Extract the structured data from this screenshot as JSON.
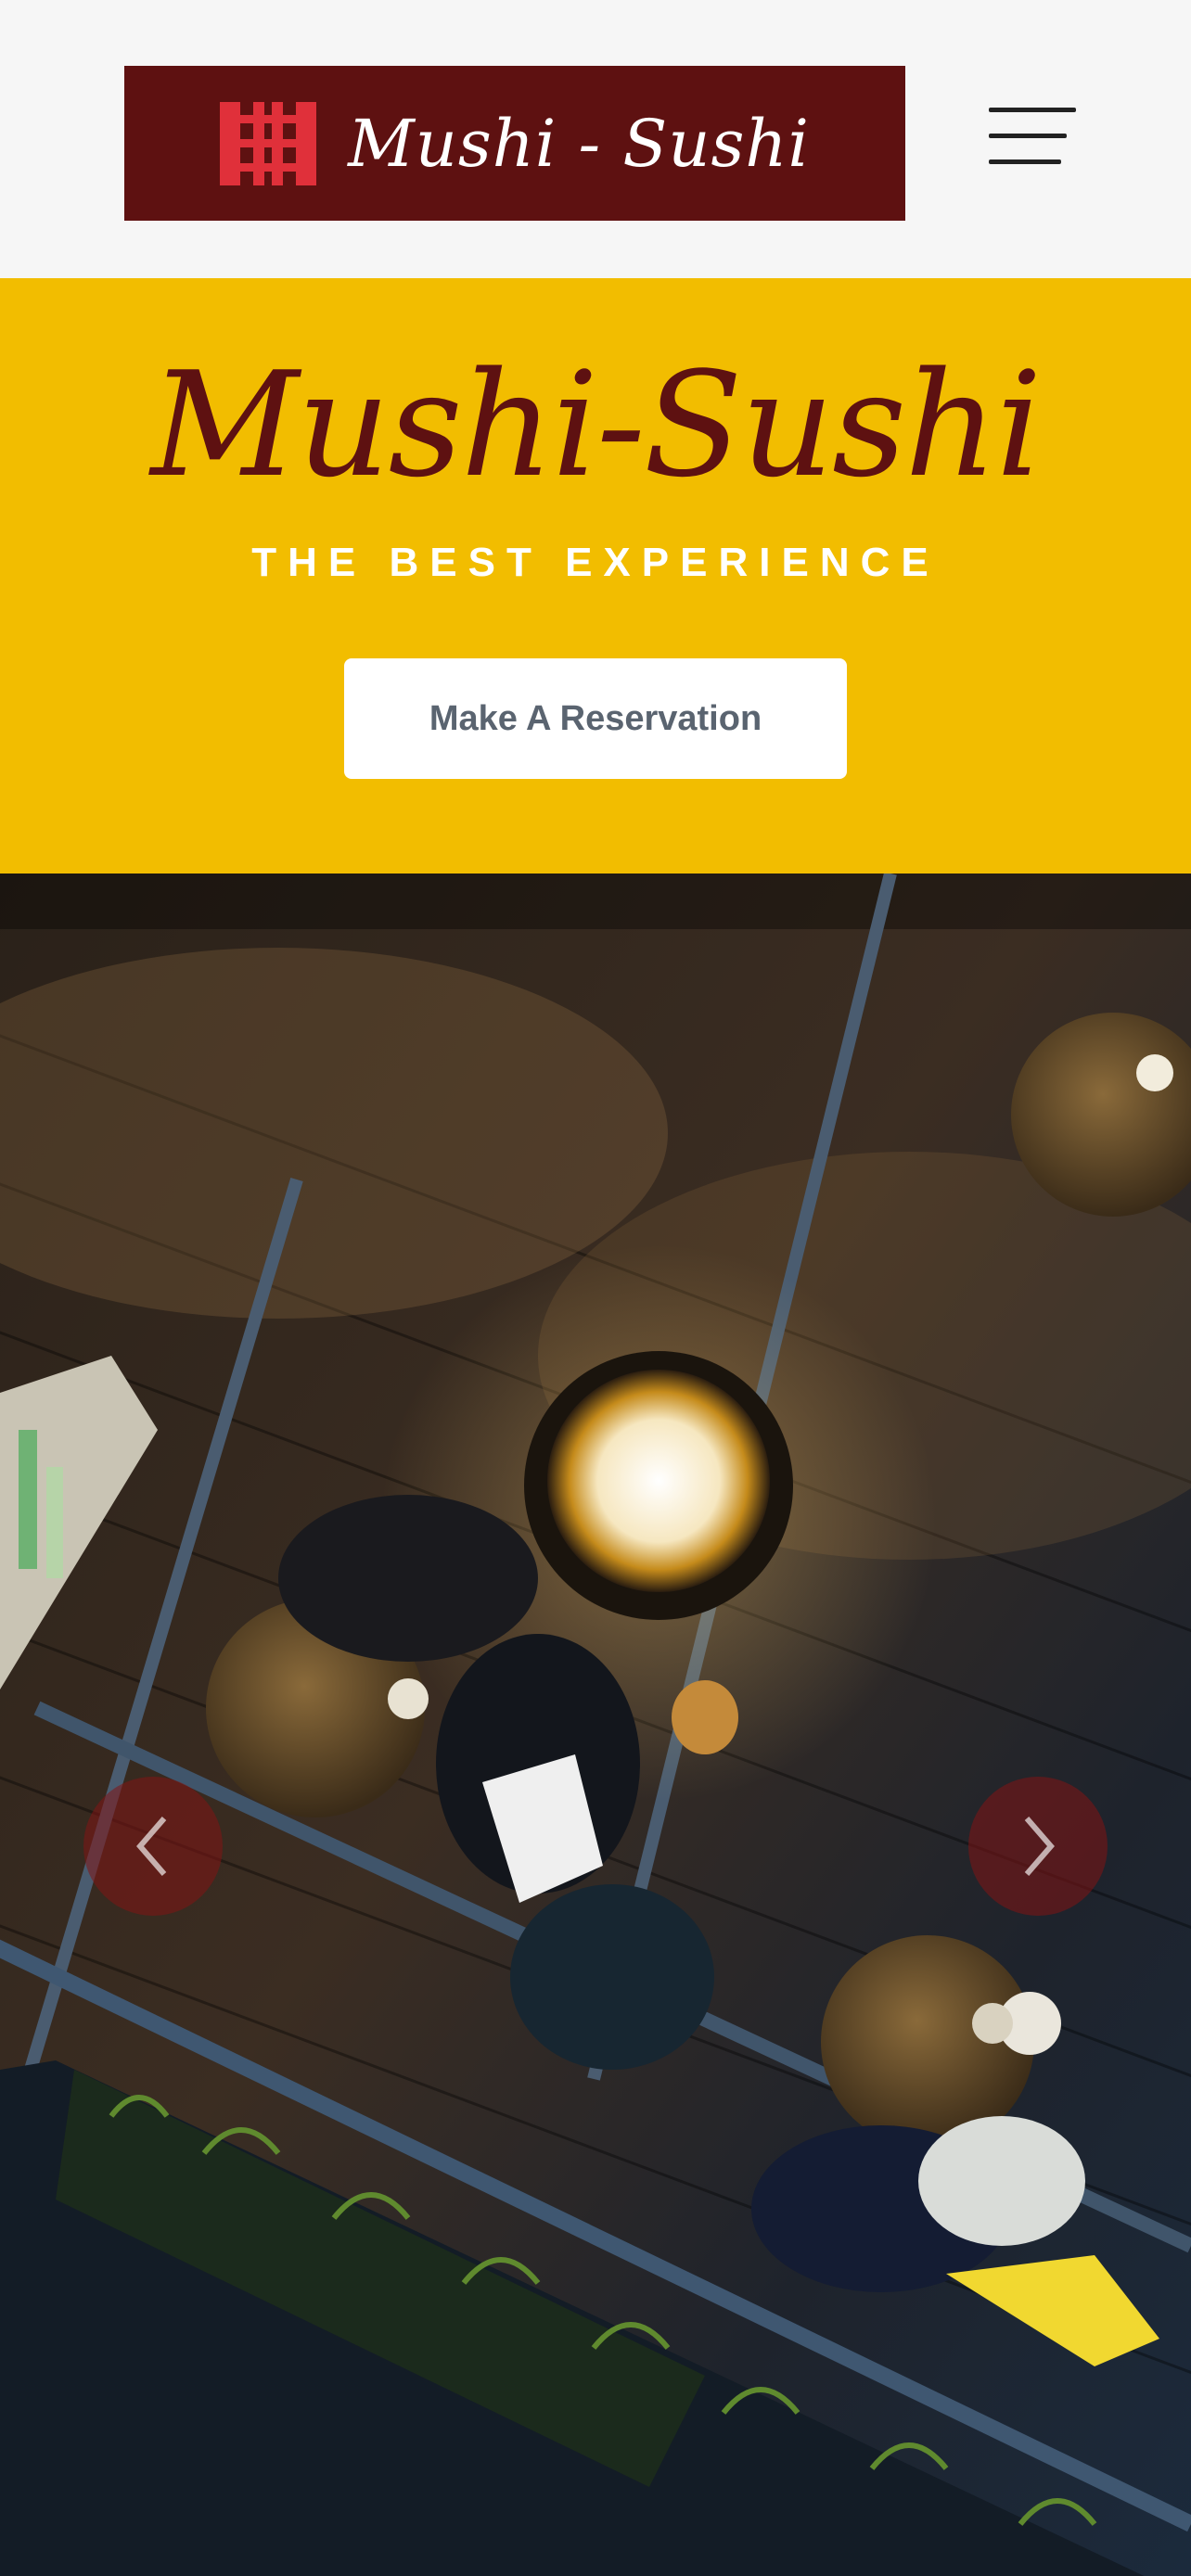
{
  "header": {
    "logo_text": "Mushi - Sushi",
    "logo_icon": "shoji-screen-icon",
    "menu_icon": "hamburger-menu-icon"
  },
  "hero": {
    "title": "Mushi-Sushi",
    "subtitle": "THE BEST EXPERIENCE",
    "cta_label": "Make A Reservation"
  },
  "carousel": {
    "prev_icon": "chevron-left-icon",
    "next_icon": "chevron-right-icon"
  },
  "colors": {
    "brand_maroon": "#5e1111",
    "brand_red": "#e0303a",
    "hero_yellow": "#f2bd00",
    "button_text": "#5a6470"
  }
}
